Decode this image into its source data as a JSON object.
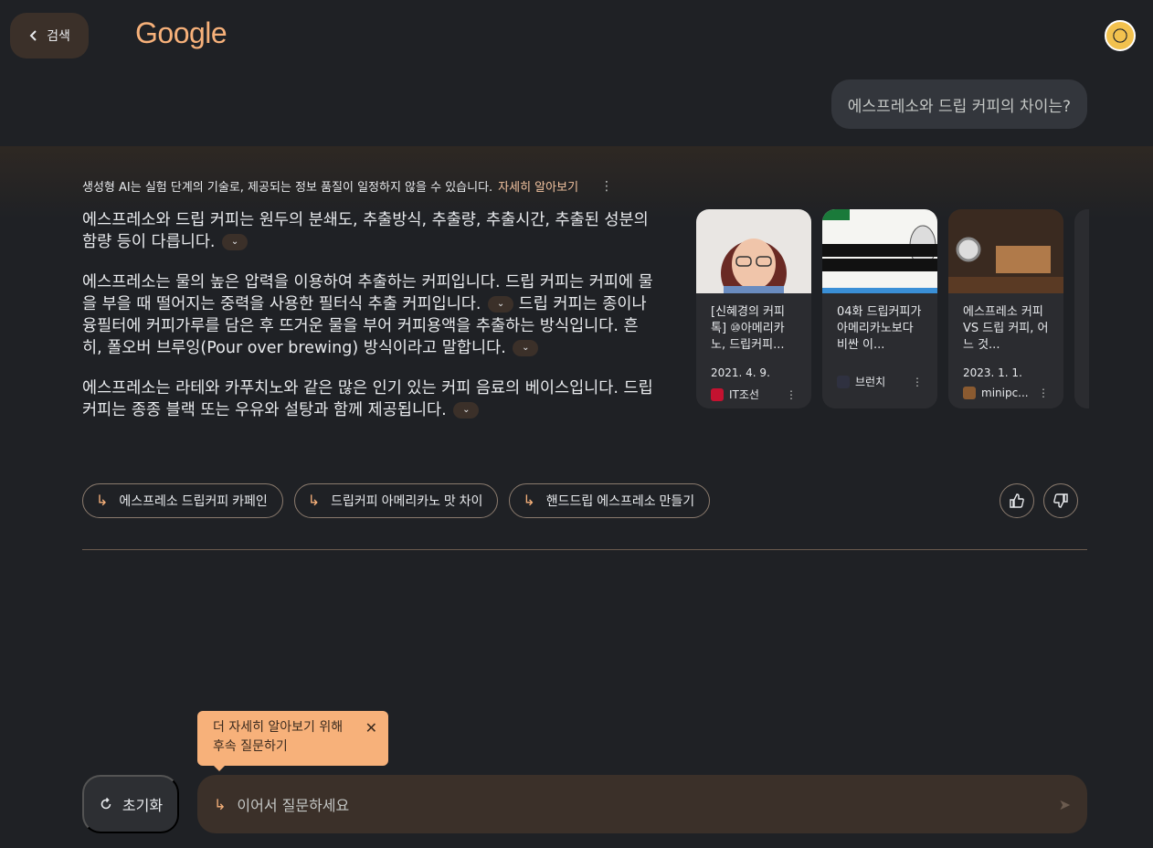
{
  "header": {
    "back_label": "검색",
    "logo_text": "Google"
  },
  "query": "에스프레소와 드립 커피의 차이는?",
  "disclaimer": {
    "text": "생성형 AI는 실험 단계의 기술로, 제공되는 정보 품질이 일정하지 않을 수 있습니다.",
    "link": "자세히 알아보기"
  },
  "answer": {
    "p1": "에스프레소와 드립 커피는 원두의 분쇄도, 추출방식, 추출량, 추출시간, 추출된 성분의 함량 등이 다릅니다.",
    "p2a": "에스프레소는 물의 높은 압력을 이용하여 추출하는 커피입니다. 드립 커피는 커피에 물을 부을 때 떨어지는 중력을 사용한 필터식 추출 커피입니다.",
    "p2b": "드립 커피는 종이나 융필터에 커피가루를 담은 후 뜨거운 물을 부어 커피용액을 추출하는 방식입니다. 흔히, 폴오버 브루잉(Pour over brewing) 방식이라고 말합니다.",
    "p3": "에스프레소는 라테와 카푸치노와 같은 많은 인기 있는 커피 음료의 베이스입니다. 드립 커피는 종종 블랙 또는 우유와 설탕과 함께 제공됩니다."
  },
  "sources": [
    {
      "title": "[신혜경의 커피톡] ⑩아메리카노, 드립커피...",
      "date": "2021. 4. 9.",
      "site": "IT조선"
    },
    {
      "title": "04화 드립커피가 아메리카노보다 비싼 이...",
      "date": "",
      "site": "브런치"
    },
    {
      "title": "에스프레소 커피 VS 드립 커피, 어느 것...",
      "date": "2023. 1. 1.",
      "site": "minipc..."
    }
  ],
  "followups": [
    "에스프레소 드립커피 카페인",
    "드립커피 아메리카노 맛 차이",
    "핸드드립 에스프레소 만들기"
  ],
  "tooltip": {
    "line1": "더 자세히 알아보기 위해",
    "line2": "후속 질문하기"
  },
  "bottom": {
    "reset_label": "초기화",
    "placeholder": "이어서 질문하세요"
  }
}
